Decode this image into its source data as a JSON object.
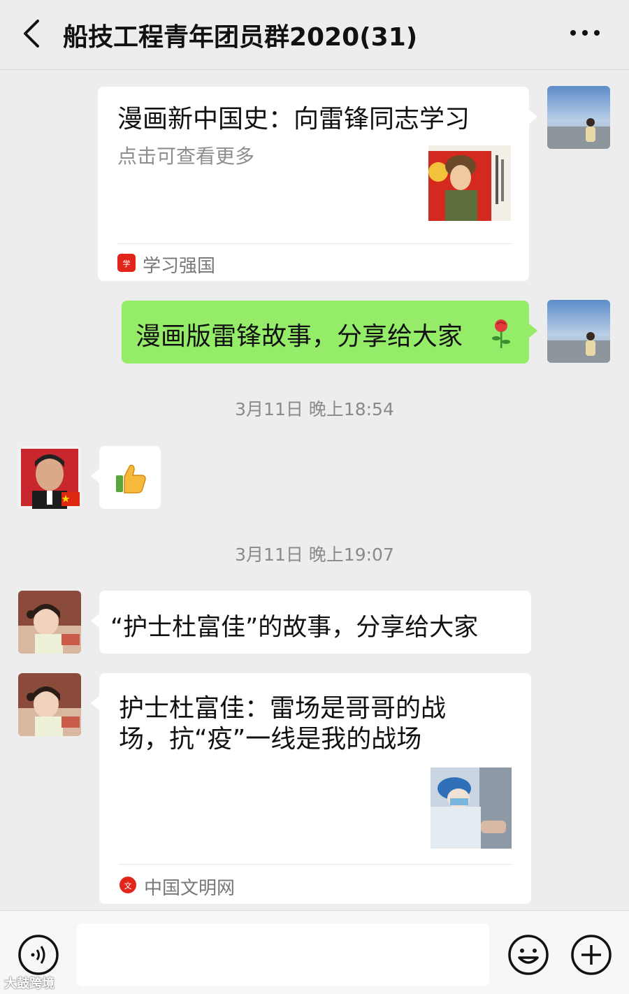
{
  "header": {
    "title": "船技工程青年团员群2020(31)",
    "back_icon": "chevron-left-icon",
    "more_icon": "ellipsis-icon"
  },
  "messages": [
    {
      "type": "link-card",
      "side": "right",
      "title": "漫画新中国史：向雷锋同志学习",
      "desc": "点击可查看更多",
      "source": "学习强国"
    },
    {
      "type": "text",
      "side": "right",
      "text": "漫画版雷锋故事，分享给大家",
      "emoji": "rose-emoji"
    },
    {
      "type": "timestamp",
      "text": "3月11日 晚上18:54"
    },
    {
      "type": "emoji",
      "side": "left",
      "emoji": "thumbs-up-emoji"
    },
    {
      "type": "timestamp",
      "text": "3月11日 晚上19:07"
    },
    {
      "type": "text",
      "side": "left",
      "text": "“护士杜富佳”的故事，分享给大家"
    },
    {
      "type": "link-card",
      "side": "left",
      "title_line1": "护士杜富佳：雷场是哥哥的战",
      "title_line2": "场，抗“疫”一线是我的战场",
      "source": "中国文明网"
    }
  ],
  "bottom_bar": {
    "input_value": "",
    "voice_icon": "voice-icon",
    "emoji_icon": "smiley-icon",
    "plus_icon": "plus-icon"
  },
  "watermark": "大鼓跨境",
  "colors": {
    "background": "#ededed",
    "sent_bubble": "#95ec69",
    "received_bubble": "#ffffff",
    "xuexi_red": "#e1251b"
  }
}
